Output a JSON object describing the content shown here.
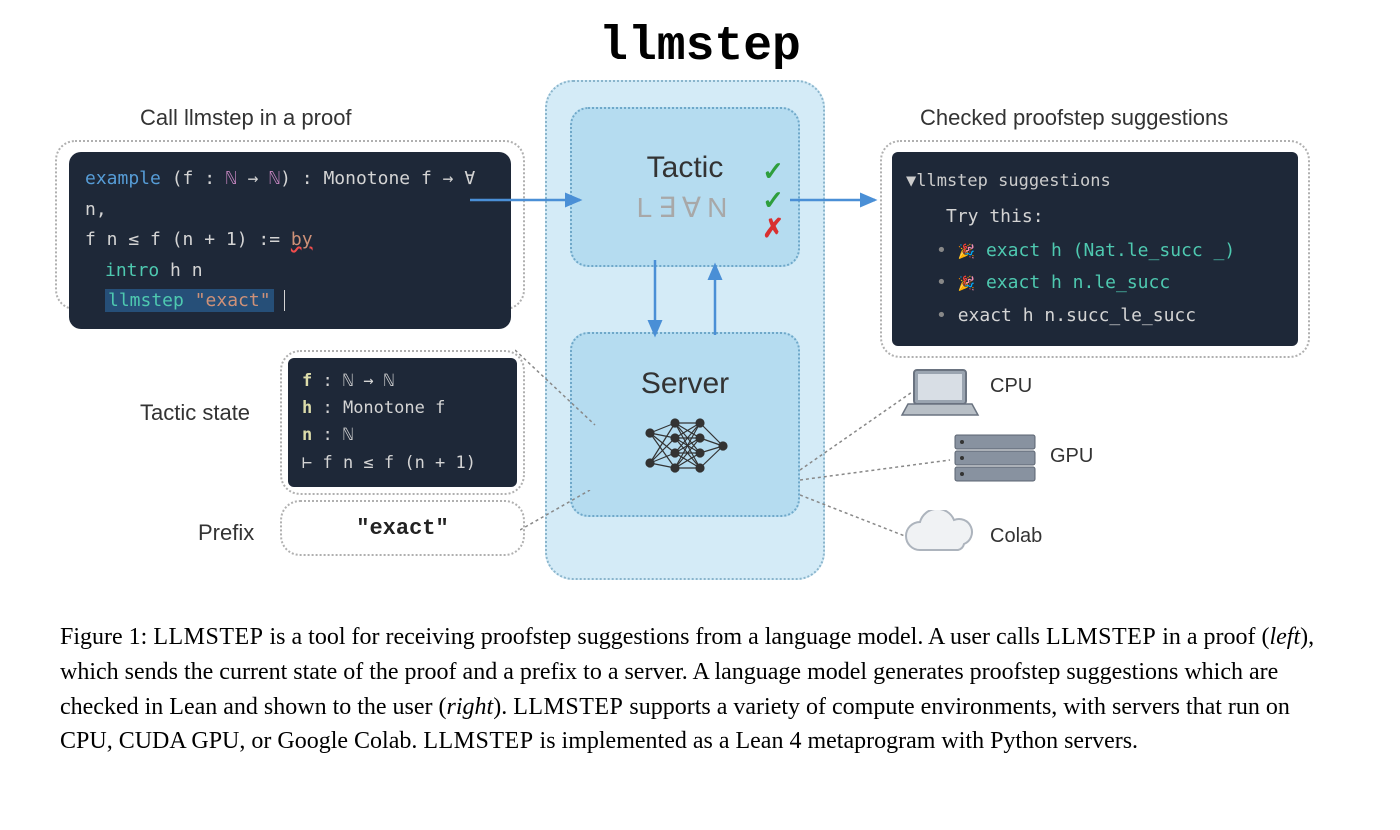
{
  "title": "llmstep",
  "left": {
    "heading": "Call llmstep in a proof",
    "code": {
      "line1_example": "example",
      "line1_sig": " (f : ",
      "line1_nat": "ℕ",
      "line1_arrow": " → ",
      "line1_nat2": "ℕ",
      "line1_rest": ") : Monotone f → ∀ n,",
      "line2": "  f n ≤ f (n + 1) := ",
      "line2_by": "by",
      "line3_tac": "intro",
      "line3_rest": " h n",
      "line4_tac": "llmstep",
      "line4_mid": " ",
      "line4_str": "\"exact\""
    },
    "tactic_state_label": "Tactic state",
    "tactic_state": {
      "f": "f",
      "f_type": " : ℕ → ℕ",
      "h": "h",
      "h_type": " : Monotone f",
      "n": "n",
      "n_type": " : ℕ",
      "goal": "⊢ f n ≤ f (n + 1)"
    },
    "prefix_label": "Prefix",
    "prefix_value": "\"exact\""
  },
  "center": {
    "tactic_label": "Tactic",
    "lean_logo": "L∃∀N",
    "server_label": "Server"
  },
  "right": {
    "heading": "Checked proofstep suggestions",
    "suggestions": {
      "header": "▼llmstep suggestions",
      "try": "Try this:",
      "items": [
        {
          "party": true,
          "text": "exact h (Nat.le_succ _)"
        },
        {
          "party": true,
          "text": "exact h n.le_succ"
        },
        {
          "party": false,
          "text": "exact h n.succ_le_succ"
        }
      ]
    },
    "compute": {
      "cpu": "CPU",
      "gpu": "GPU",
      "colab": "Colab"
    }
  },
  "caption": {
    "fig": "Figure 1: ",
    "s1a": "LLMSTEP",
    "s1b": " is a tool for receiving proofstep suggestions from a language model. A user calls ",
    "s2a": "LLMSTEP",
    "s2b": " in a proof (",
    "s2c": "left",
    "s2d": "), which sends the current state of the proof and a prefix to a server. A language model generates proofstep suggestions which are checked in Lean and shown to the user (",
    "s3c": "right",
    "s3d": "). ",
    "s4a": "LLMSTEP",
    "s4b": " supports a variety of compute environments, with servers that run on CPU, CUDA GPU, or Google Colab. ",
    "s5a": "LLMSTEP",
    "s5b": " is implemented as a Lean 4 metaprogram with Python servers."
  }
}
